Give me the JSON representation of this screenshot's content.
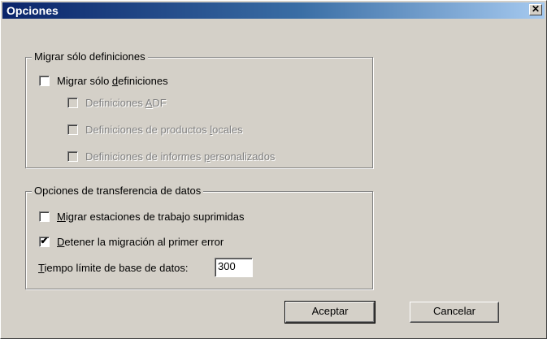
{
  "window": {
    "title": "Opciones",
    "close_glyph": "✕"
  },
  "group1": {
    "legend": "Migrar sólo definiciones",
    "main_checkbox": {
      "pre": "Migrar sólo ",
      "accel": "d",
      "post": "efiniciones",
      "checked": false
    },
    "sub": [
      {
        "pre": "Definiciones ",
        "accel": "A",
        "post": "DF",
        "checked": false,
        "enabled": false
      },
      {
        "pre": "Definiciones de productos ",
        "accel": "l",
        "post": "ocales",
        "checked": false,
        "enabled": false
      },
      {
        "pre": "Definiciones de informes ",
        "accel": "p",
        "post": "ersonalizados",
        "checked": false,
        "enabled": false
      }
    ]
  },
  "group2": {
    "legend": "Opciones de transferencia de datos",
    "option1": {
      "pre": "",
      "accel": "M",
      "post": "igrar estaciones de trabajo suprimidas",
      "checked": false
    },
    "option2": {
      "pre": "",
      "accel": "D",
      "post": "etener la migración al primer error",
      "checked": true,
      "mark": "✔"
    },
    "timeout": {
      "accel": "T",
      "label_rest": "iempo límite de base de datos:",
      "value": "300"
    }
  },
  "buttons": {
    "ok": "Aceptar",
    "cancel": "Cancelar"
  }
}
